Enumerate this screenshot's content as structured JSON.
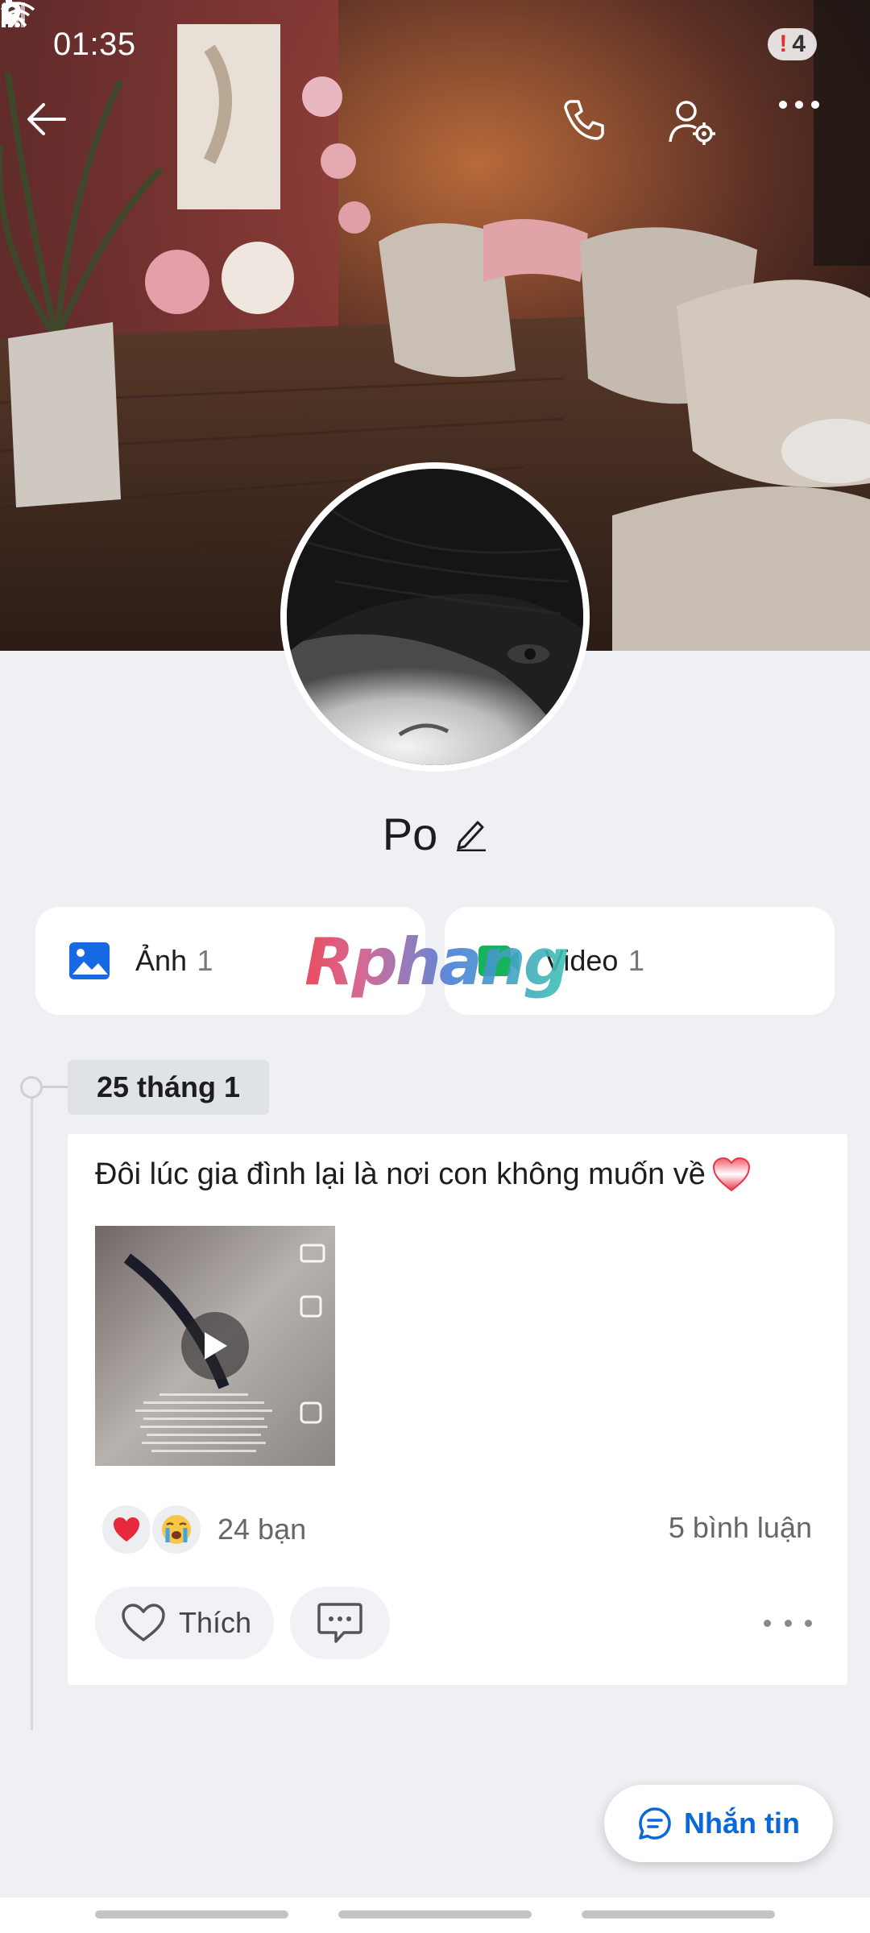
{
  "status_bar": {
    "time": "01:35",
    "notification_count": "4",
    "icons": [
      "battery-alert-icon",
      "mute-icon",
      "location-icon",
      "wifi-icon",
      "signal-icon"
    ]
  },
  "nav": {
    "icons": [
      "back-arrow-icon",
      "phone-icon",
      "user-settings-icon",
      "more-icon"
    ]
  },
  "profile": {
    "name": "Po"
  },
  "media": {
    "photos_label": "Ảnh",
    "photos_count": "1",
    "videos_label": "Video",
    "videos_count": "1"
  },
  "watermark": "Rphang",
  "timeline": {
    "date": "25 tháng 1"
  },
  "post": {
    "text": "Đôi lúc gia đình lại là nơi con không muốn về",
    "reactions_count": "24 bạn",
    "comments_count": "5 bình luận",
    "like_label": "Thích"
  },
  "message_button": {
    "label": "Nhắn tin"
  },
  "colors": {
    "accent": "#0a68d8",
    "background": "#eef0f4",
    "photo_icon": "#1668e3"
  }
}
